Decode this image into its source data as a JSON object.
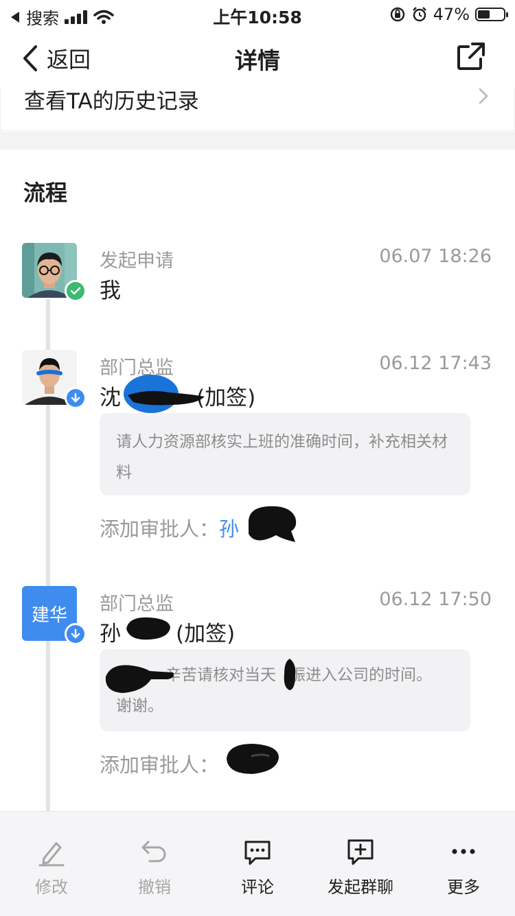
{
  "status_bar": {
    "carrier": "搜索",
    "time": "上午10:58",
    "battery": "47%",
    "battery_level": 0.47
  },
  "nav": {
    "back_label": "返回",
    "title": "详情"
  },
  "history": {
    "label": "查看TA的历史记录"
  },
  "flow": {
    "title": "流程",
    "steps": [
      {
        "role": "发起申请",
        "time": "06.07 18:26",
        "name": "我",
        "badge": "check-icon",
        "badge_color": "#3cba6e"
      },
      {
        "role": "部门总监",
        "time": "06.12 17:43",
        "name": "沈",
        "name_suffix": "(加签)",
        "comment": "请人力资源部核实上班的准确时间，补充相关材料",
        "approver_label": "添加审批人：",
        "approver_name": "孙",
        "badge": "arrow-down-icon",
        "badge_color": "#3f8cef"
      },
      {
        "role": "部门总监",
        "time": "06.12 17:50",
        "avatar_text": "建华",
        "name": "孙",
        "name_suffix": "(加签)",
        "comment_line1": "辛苦请核对当天",
        "comment_line1b": "振进入公司的时间。",
        "comment_line2": "谢谢。",
        "approver_label": "添加审批人：",
        "badge": "arrow-down-icon",
        "badge_color": "#3f8cef"
      }
    ]
  },
  "toolbar": {
    "items": [
      {
        "label": "修改",
        "icon": "pencil-icon",
        "enabled": false
      },
      {
        "label": "撤销",
        "icon": "undo-icon",
        "enabled": false
      },
      {
        "label": "评论",
        "icon": "comment-icon",
        "enabled": true
      },
      {
        "label": "发起群聊",
        "icon": "add-chat-icon",
        "enabled": true
      },
      {
        "label": "更多",
        "icon": "more-icon",
        "enabled": true
      }
    ]
  },
  "colors": {
    "accent": "#3f8cef",
    "success": "#3cba6e",
    "muted_text": "#9a9a9a",
    "comment_bg": "#f2f2f5"
  }
}
